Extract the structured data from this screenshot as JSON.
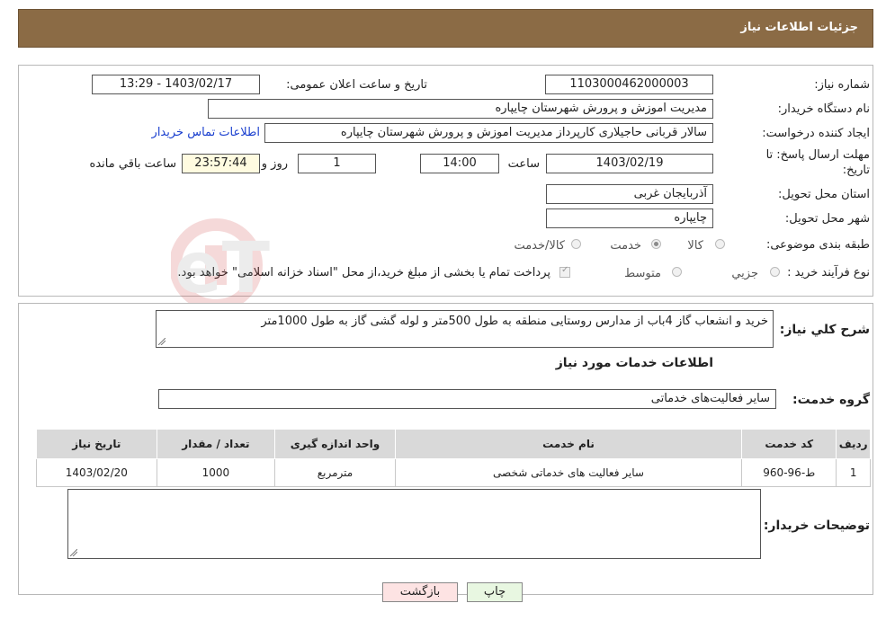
{
  "header": {
    "title": "جزئیات اطلاعات نیاز"
  },
  "info": {
    "need_number_label": "شماره نیاز:",
    "need_number": "1103000462000003",
    "announce_label": "تاریخ و ساعت اعلان عمومی:",
    "announce_value": "1403/02/17 - 13:29",
    "buyer_org_label": "نام دستگاه خریدار:",
    "buyer_org": "مدیریت اموزش و پرورش شهرستان چایپاره",
    "creator_label": "ایجاد کننده درخواست:",
    "creator": "سالار قربانی حاجیلاری کارپرداز مدیریت اموزش و پرورش شهرستان چایپاره",
    "contact_link": "اطلاعات تماس خریدار",
    "deadline_label_1": "مهلت ارسال پاسخ: تا",
    "deadline_label_2": "تاریخ:",
    "deadline_date": "1403/02/19",
    "time_label": "ساعت",
    "deadline_time": "14:00",
    "days_value": "1",
    "days_label": "روز و",
    "remaining_time": "23:57:44",
    "remaining_label": "ساعت باقي مانده",
    "province_label": "استان محل تحویل:",
    "province": "آذربایجان غربی",
    "city_label": "شهر محل تحویل:",
    "city": "چایپاره",
    "category_label": "طبقه بندی موضوعی:",
    "category_options": [
      "کالا",
      "خدمت",
      "کالا/خدمت"
    ],
    "process_label": "نوع فرآیند خرید :",
    "process_options": [
      "جزیي",
      "متوسط"
    ],
    "payment_note": "پرداخت تمام یا بخشی از مبلغ خرید،از محل \"اسناد خزانه اسلامی\" خواهد بود."
  },
  "description": {
    "label": "شرح کلي نياز:",
    "text": "خرید و انشعاب گاز 4باب از مدارس روستایی منطقه به طول 500متر و لوله گشی گاز به طول 1000متر"
  },
  "services": {
    "section_title": "اطلاعات خدمات مورد نیاز",
    "group_label": "گروه خدمت:",
    "group_value": "سایر فعالیت‌های خدماتی",
    "columns": [
      "ردیف",
      "کد خدمت",
      "نام خدمت",
      "واحد اندازه گیری",
      "تعداد / مقدار",
      "تاریخ نیاز"
    ],
    "rows": [
      [
        "1",
        "ط-96-960",
        "سایر فعالیت های خدماتی شخصی",
        "مترمربع",
        "1000",
        "1403/02/20"
      ]
    ]
  },
  "buyer_notes": {
    "label": "توضیحات خریدار:",
    "text": ""
  },
  "buttons": {
    "print": "چاپ",
    "back": "بازگشت"
  },
  "colors": {
    "header_bg": "#8b6b45",
    "back_bg": "#fde3e3",
    "print_bg": "#e8f7e1"
  }
}
